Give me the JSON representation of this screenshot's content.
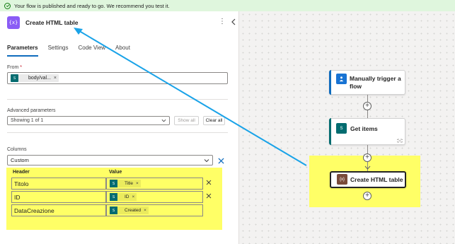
{
  "banner": {
    "message": "Your flow is published and ready to go. We recommend you test it."
  },
  "panel": {
    "action_icon_text": "{x}",
    "title": "Create HTML table",
    "more_label": "⋮",
    "tabs": [
      {
        "label": "Parameters",
        "active": true
      },
      {
        "label": "Settings",
        "active": false
      },
      {
        "label": "Code View",
        "active": false
      },
      {
        "label": "About",
        "active": false
      }
    ],
    "from": {
      "label": "From",
      "required_mark": "*",
      "token_icon": "S",
      "token_text": "body/val...",
      "token_remove": "×"
    },
    "advanced": {
      "label": "Advanced parameters",
      "showing": "Showing 1 of 1",
      "show_all": "Show all",
      "clear_all": "Clear all"
    },
    "columns": {
      "label": "Columns",
      "mode": "Custom",
      "header_label": "Header",
      "value_label": "Value",
      "rows": [
        {
          "header": "Titolo",
          "value": "Title"
        },
        {
          "header": "ID",
          "value": "ID"
        },
        {
          "header": "DataCreazione",
          "value": "Created"
        }
      ],
      "remove_glyph": "×"
    }
  },
  "canvas": {
    "trigger": {
      "title_line1": "Manually trigger a",
      "title_line2": "flow"
    },
    "get_items": {
      "title": "Get items",
      "icon_text": "S"
    },
    "create_table": {
      "title": "Create HTML table",
      "icon_text": "{x}"
    },
    "plus_glyph": "+"
  },
  "colors": {
    "brand_blue": "#0f6cbd",
    "highlight": "#ffff66",
    "action_purple": "#8a5cf5",
    "sharepoint_teal": "#036c70",
    "arrow_blue": "#1aa3e8"
  }
}
